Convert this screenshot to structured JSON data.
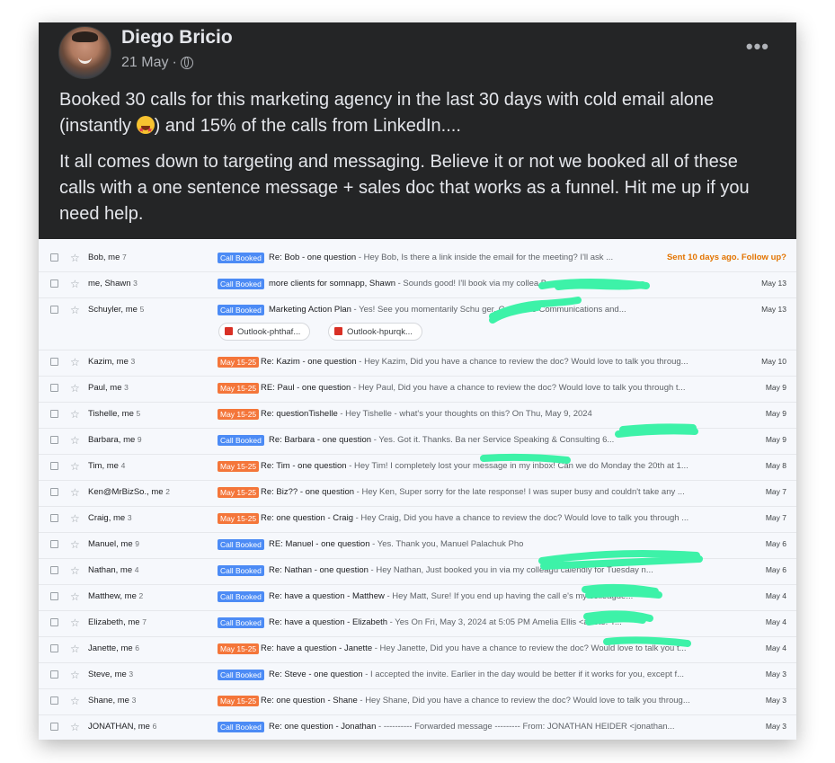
{
  "post": {
    "author": "Diego Bricio",
    "date": "21 May",
    "audience_icon": "globe-icon",
    "more_icon": "more-options-icon",
    "paragraph1_a": "Booked 30 calls for this marketing agency in the last 30 days with cold email alone (instantly ",
    "paragraph1_emoji": "star-struck-emoji",
    "paragraph1_b": ")  and 15% of the calls from LinkedIn....",
    "paragraph2": "It all comes down to targeting and messaging. Believe it or not we booked all of these calls with a one sentence message + sales doc that works as a funnel. Hit me up if you need help."
  },
  "colors": {
    "post_bg": "#242526",
    "label_call_booked": "#4c8bf5",
    "label_date": "#f4763a",
    "follow_up": "#e37400",
    "redaction": "#3df2a8"
  },
  "inbox": {
    "rows": [
      {
        "sender": "Bob, me",
        "count": "7",
        "label": "Call Booked",
        "label_color": "blue",
        "subject": "Re: Bob - one question",
        "snippet": " - Hey Bob, Is there a link inside the email for the meeting? I'll ask ...",
        "date": "Sent 10 days ago. Follow up?"
      },
      {
        "sender": "me, Shawn",
        "count": "3",
        "label": "Call Booked",
        "label_color": "blue",
        "subject": "more clients for somnapp, Shawn",
        "snippet": " - Sounds good! I'll book via my collea              Best, On Mon, May...",
        "date": "May 13"
      },
      {
        "sender": "Schuyler, me",
        "count": "5",
        "label": "Call Booked",
        "label_color": "blue",
        "subject": "Marketing Action Plan",
        "snippet": " - Yes! See you momentarily Schu              ger, Corporate Communications and...",
        "date": "May 13",
        "attachments": [
          "Outlook-phthaf...",
          "Outlook-hpurqk..."
        ]
      },
      {
        "sender": "Kazim, me",
        "count": "3",
        "label": "May 15-25",
        "label_color": "orange",
        "subject": "Re: Kazim - one question",
        "snippet": " - Hey Kazim, Did you have a chance to review the doc? Would love to talk you throug...",
        "date": "May 10"
      },
      {
        "sender": "Paul, me",
        "count": "3",
        "label": "May 15-25",
        "label_color": "orange",
        "subject": "RE: Paul - one question",
        "snippet": " - Hey Paul, Did you have a chance to review the doc? Would love to talk you through t...",
        "date": "May 9"
      },
      {
        "sender": "Tishelle, me",
        "count": "5",
        "label": "May 15-25",
        "label_color": "orange",
        "subject": "Re: questionTishelle",
        "snippet": " - Hey Tishelle - what's your thoughts on this? On Thu, May 9, 2024",
        "date": "May 9"
      },
      {
        "sender": "Barbara, me",
        "count": "9",
        "label": "Call Booked",
        "label_color": "blue",
        "subject": "Re: Barbara - one question",
        "snippet": " - Yes. Got it. Thanks. Ba                    ner Service Speaking & Consulting 6...",
        "date": "May 9"
      },
      {
        "sender": "Tim, me",
        "count": "4",
        "label": "May 15-25",
        "label_color": "orange",
        "subject": "Re: Tim - one question",
        "snippet": " - Hey Tim! I completely lost your message in my inbox! Can we do Monday the 20th at 1...",
        "date": "May 8"
      },
      {
        "sender": "Ken@MrBizSo., me",
        "count": "2",
        "label": "May 15-25",
        "label_color": "orange",
        "subject": "Re: Biz?? - one question",
        "snippet": " - Hey Ken, Super sorry for the late response! I was super busy and couldn't take any ...",
        "date": "May 7"
      },
      {
        "sender": "Craig, me",
        "count": "3",
        "label": "May 15-25",
        "label_color": "orange",
        "subject": "Re: one question - Craig",
        "snippet": " - Hey Craig, Did you have a chance to review the doc? Would love to talk you through ...",
        "date": "May 7"
      },
      {
        "sender": "Manuel, me",
        "count": "9",
        "label": "Call Booked",
        "label_color": "blue",
        "subject": "RE: Manuel - one question",
        "snippet": " - Yes. Thank you, Manuel Palachuk Pho",
        "date": "May 6"
      },
      {
        "sender": "Nathan, me",
        "count": "4",
        "label": "Call Booked",
        "label_color": "blue",
        "subject": "Re: Nathan - one question",
        "snippet": " - Hey Nathan, Just booked you in via my colleagu             calendly for Tuesday n...",
        "date": "May 6"
      },
      {
        "sender": "Matthew, me",
        "count": "2",
        "label": "Call Booked",
        "label_color": "blue",
        "subject": "Re: have a question - Matthew",
        "snippet": " - Hey Matt, Sure! If you end up having the call               e's my colleague...",
        "date": "May 4"
      },
      {
        "sender": "Elizabeth, me",
        "count": "7",
        "label": "Call Booked",
        "label_color": "blue",
        "subject": "Re: have a question - Elizabeth",
        "snippet": " - Yes On Fri, May 3, 2024 at 5:05 PM Amelia Ellis <a              rote: Y...",
        "date": "May 4"
      },
      {
        "sender": "Janette, me",
        "count": "6",
        "label": "May 15-25",
        "label_color": "orange",
        "subject": "Re: have a question - Janette",
        "snippet": " - Hey Janette, Did you have a chance to review the doc? Would love to talk you t...",
        "date": "May 4"
      },
      {
        "sender": "Steve, me",
        "count": "3",
        "label": "Call Booked",
        "label_color": "blue",
        "subject": "Re: Steve - one question",
        "snippet": " - I accepted the invite. Earlier in the day would be better if it works for you, except f...",
        "date": "May 3"
      },
      {
        "sender": "Shane, me",
        "count": "3",
        "label": "May 15-25",
        "label_color": "orange",
        "subject": "Re: one question - Shane",
        "snippet": " - Hey Shane, Did you have a chance to review the doc? Would love to talk you throug...",
        "date": "May 3"
      },
      {
        "sender": "JONATHAN, me",
        "count": "6",
        "label": "Call Booked",
        "label_color": "blue",
        "subject": "Re: one question - Jonathan",
        "snippet": " - ---------- Forwarded message --------- From: JONATHAN HEIDER <jonathan...",
        "date": "May 3"
      }
    ]
  }
}
